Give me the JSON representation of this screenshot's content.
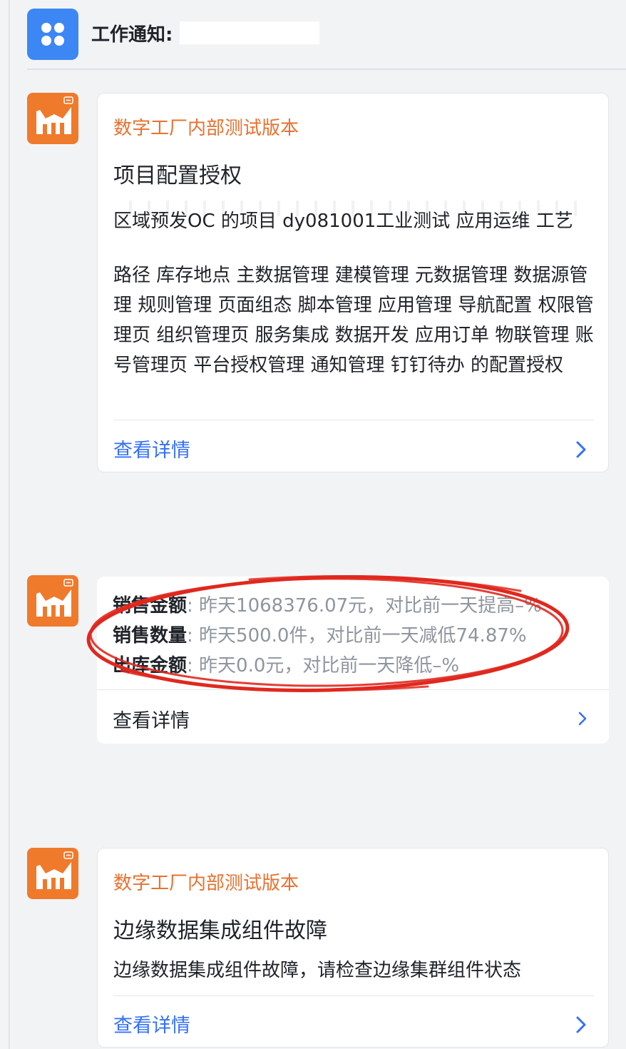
{
  "header": {
    "title": "工作通知:"
  },
  "cards": [
    {
      "source": "数字工厂内部测试版本",
      "title": "项目配置授权",
      "body_line_cut": "区域预发OC 的项目 dy081001工业测试 应用运维 工艺",
      "body": "路径 库存地点 主数据管理 建模管理 元数据管理 数据源管理 规则管理 页面组态 脚本管理 应用管理 导航配置 权限管理页 组织管理页 服务集成 数据开发 应用订单 物联管理 账号管理页 平台授权管理 通知管理 钉钉待办 的配置授权",
      "link": "查看详情"
    },
    {
      "stats": [
        {
          "key": "销售金额",
          "value": ": 昨天1068376.07元，对比前一天提高–%"
        },
        {
          "key": "销售数量",
          "value": ": 昨天500.0件，对比前一天减低74.87%"
        },
        {
          "key": "出库金额",
          "value": ": 昨天0.0元，对比前一天降低–%"
        }
      ],
      "link": "查看详情"
    },
    {
      "source": "数字工厂内部测试版本",
      "title": "边缘数据集成组件故障",
      "body": "边缘数据集成组件故障，请检查边缘集群组件状态",
      "link": "查看详情"
    }
  ],
  "colors": {
    "accent_blue": "#3370ff",
    "app_orange": "#f07a2b",
    "source_orange": "#e8712f",
    "annotation_red": "#e0281e"
  },
  "icons": {
    "header": "workspace-grid-icon",
    "app": "factory-chart-icon",
    "chevron": "chevron-right-icon"
  }
}
